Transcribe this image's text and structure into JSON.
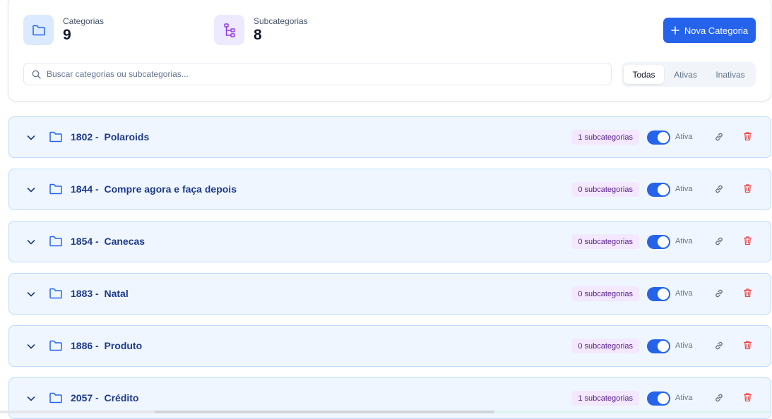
{
  "stats": {
    "categories": {
      "label": "Categorias",
      "value": "9",
      "icon": "folder-icon"
    },
    "subcategories": {
      "label": "Subcategorias",
      "value": "8",
      "icon": "hierarchy-icon"
    }
  },
  "new_button": {
    "label": "Nova Categoria",
    "icon": "plus-icon"
  },
  "search": {
    "placeholder": "Buscar categorias ou subcategorias...",
    "value": ""
  },
  "filters": [
    {
      "label": "Todas",
      "active": true
    },
    {
      "label": "Ativas",
      "active": false
    },
    {
      "label": "Inativas",
      "active": false
    }
  ],
  "categories": [
    {
      "title": "1802 -  Polaroids",
      "badge": "1 subcategorias",
      "status": "Ativa",
      "enabled": true
    },
    {
      "title": "1844 -  Compre agora e faça depois",
      "badge": "0 subcategorias",
      "status": "Ativa",
      "enabled": true
    },
    {
      "title": "1854 -  Canecas",
      "badge": "0 subcategorias",
      "status": "Ativa",
      "enabled": true
    },
    {
      "title": "1883 -  Natal",
      "badge": "0 subcategorias",
      "status": "Ativa",
      "enabled": true
    },
    {
      "title": "1886 -  Produto",
      "badge": "0 subcategorias",
      "status": "Ativa",
      "enabled": true
    },
    {
      "title": "2057 -  Crédito",
      "badge": "1 subcategorias",
      "status": "Ativa",
      "enabled": true
    }
  ],
  "colors": {
    "accent": "#2563eb",
    "row_bg": "#eff6ff",
    "row_border": "#bfdbfe",
    "badge_bg": "#f3e8ff",
    "delete": "#ef4444"
  }
}
